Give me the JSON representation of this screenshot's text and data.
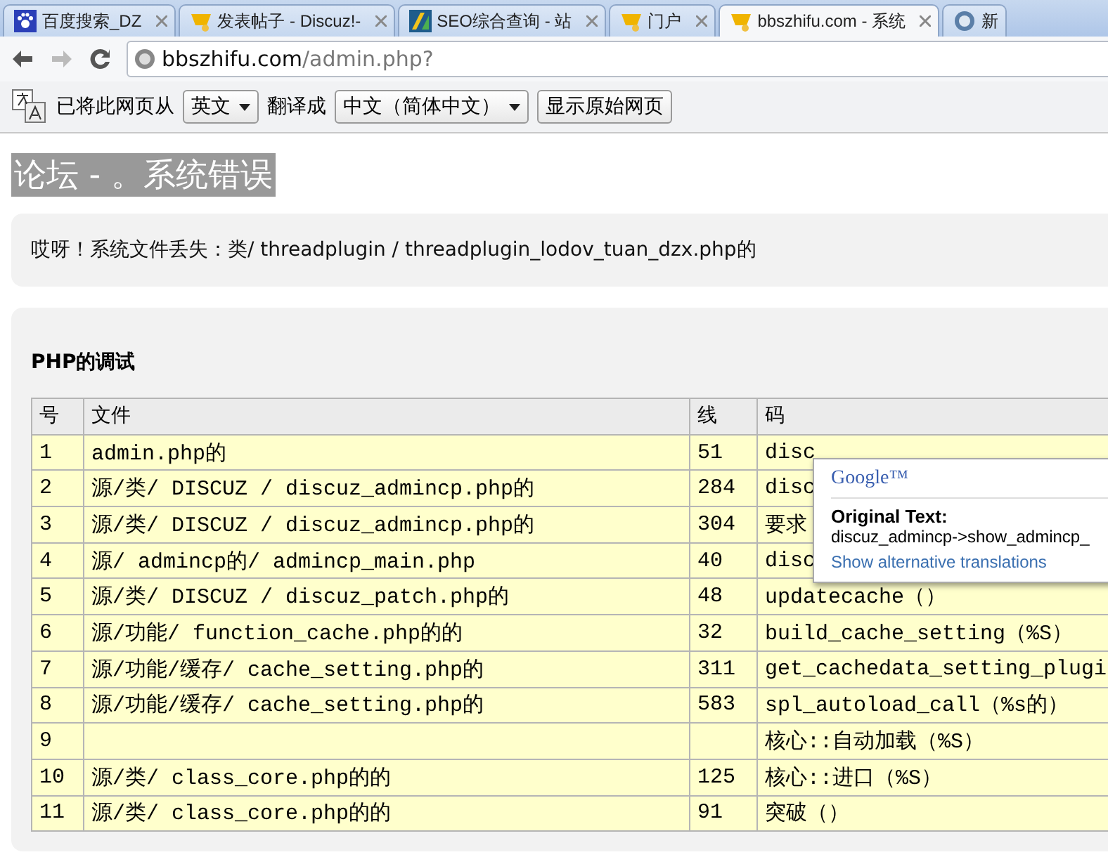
{
  "tabs": [
    {
      "label": "百度搜索_DZ",
      "kind": "paw",
      "selected": false,
      "closable": true
    },
    {
      "label": "发表帖子 - Discuz!-",
      "kind": "cup",
      "selected": false,
      "closable": true
    },
    {
      "label": "SEO综合查询 - 站",
      "kind": "chart",
      "selected": false,
      "closable": true
    },
    {
      "label": "门户",
      "kind": "cup",
      "selected": false,
      "closable": true
    },
    {
      "label": "bbszhifu.com - 系统",
      "kind": "cup",
      "selected": true,
      "closable": true
    },
    {
      "label": "新",
      "kind": "globe",
      "selected": false,
      "closable": false
    }
  ],
  "address": {
    "host": "bbszhifu.com",
    "path": "/admin.php?"
  },
  "translate_bar": {
    "prefix": "已将此网页从",
    "from": "英文",
    "middle": "翻译成",
    "to": "中文（简体中文）",
    "button": "显示原始网页"
  },
  "page": {
    "title": "论坛 - 。系统错误",
    "error": "哎呀！系统文件丢失：类/ threadplugin / threadplugin_lodov_tuan_dzx.php的",
    "debug_title": "PHP的调试",
    "table": {
      "columns": [
        "号",
        "文件",
        "线",
        "码"
      ],
      "rows": [
        [
          "1",
          "admin.php的",
          "51",
          "disc"
        ],
        [
          "2",
          "源/类/ DISCUZ / discuz_admincp.php的",
          "284",
          "disc"
        ],
        [
          "3",
          "源/类/ DISCUZ / discuz_admincp.php的",
          "304",
          "要求"
        ],
        [
          "4",
          "源/ admincp的/ admincp_main.php",
          "40",
          "disc"
        ],
        [
          "5",
          "源/类/ DISCUZ / discuz_patch.php的",
          "48",
          "updatecache（）"
        ],
        [
          "6",
          "源/功能/ function_cache.php的的",
          "32",
          "build_cache_setting（%S）"
        ],
        [
          "7",
          "源/功能/缓存/ cache_setting.php的",
          "311",
          "get_cachedata_setting_plugi"
        ],
        [
          "8",
          "源/功能/缓存/ cache_setting.php的",
          "583",
          "spl_autoload_call（%s的）"
        ],
        [
          "9",
          "",
          "",
          "核心::自动加载（%S）"
        ],
        [
          "10",
          "源/类/ class_core.php的的",
          "125",
          "核心::进口（%S）"
        ],
        [
          "11",
          "源/类/ class_core.php的的",
          "91",
          "突破（）"
        ]
      ]
    }
  },
  "popup": {
    "logo": "Google™",
    "heading": "Original Text:",
    "text": "discuz_admincp->show_admincp_",
    "link": "Show alternative translations"
  }
}
